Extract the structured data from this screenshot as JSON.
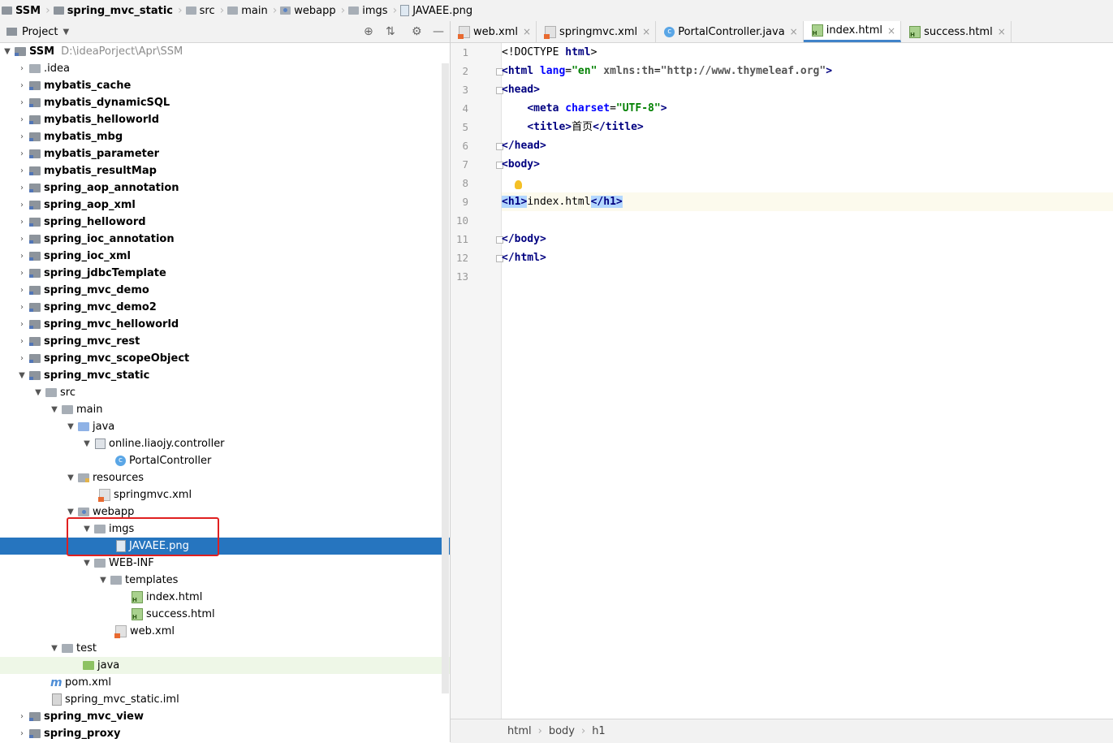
{
  "breadcrumb": [
    "SSM",
    "spring_mvc_static",
    "src",
    "main",
    "webapp",
    "imgs",
    "JAVAEE.png"
  ],
  "project_panel": {
    "title": "Project",
    "root_name": "SSM",
    "root_path": "D:\\ideaPorject\\Apr\\SSM",
    "modules": [
      ".idea",
      "mybatis_cache",
      "mybatis_dynamicSQL",
      "mybatis_helloworld",
      "mybatis_mbg",
      "mybatis_parameter",
      "mybatis_resultMap",
      "spring_aop_annotation",
      "spring_aop_xml",
      "spring_helloword",
      "spring_ioc_annotation",
      "spring_ioc_xml",
      "spring_jdbcTemplate",
      "spring_mvc_demo",
      "spring_mvc_demo2",
      "spring_mvc_helloworld",
      "spring_mvc_rest",
      "spring_mvc_scopeObject"
    ],
    "expanded_module": "spring_mvc_static",
    "nodes": {
      "src": "src",
      "main": "main",
      "java": "java",
      "package": "online.liaojy.controller",
      "controller": "PortalController",
      "resources": "resources",
      "springmvc_xml": "springmvc.xml",
      "webapp": "webapp",
      "imgs": "imgs",
      "javaee_png": "JAVAEE.png",
      "web_inf": "WEB-INF",
      "templates": "templates",
      "index_html": "index.html",
      "success_html": "success.html",
      "web_xml": "web.xml",
      "test": "test",
      "test_java": "java",
      "pom_xml": "pom.xml",
      "iml": "spring_mvc_static.iml"
    },
    "trailing_modules": [
      "spring_mvc_view",
      "spring_proxy"
    ]
  },
  "editor_tabs": [
    "web.xml",
    "springmvc.xml",
    "PortalController.java",
    "index.html",
    "success.html"
  ],
  "active_tab": "index.html",
  "line_numbers": [
    "1",
    "2",
    "3",
    "4",
    "5",
    "6",
    "7",
    "8",
    "9",
    "10",
    "11",
    "12",
    "13"
  ],
  "code": {
    "doctype": "<!DOCTYPE",
    "doctype_html": "html",
    "html_open": "<html",
    "lang_attr": "lang",
    "lang_val": "\"en\"",
    "xmlns_attr": "xmlns:th",
    "xmlns_val": "\"http://www.thymeleaf.org\"",
    "head_open": "<head>",
    "meta_open": "<meta",
    "charset_attr": "charset",
    "charset_val": "\"UTF-8\"",
    "title_open": "<title>",
    "title_text": "首页",
    "title_close": "</title>",
    "head_close": "</head>",
    "body_open": "<body>",
    "h1_open": "<h1>",
    "h1_text": "index.html",
    "h1_close": "</h1>",
    "body_close": "</body>",
    "html_close": "</html>"
  },
  "statusbar_path": [
    "html",
    "body",
    "h1"
  ]
}
